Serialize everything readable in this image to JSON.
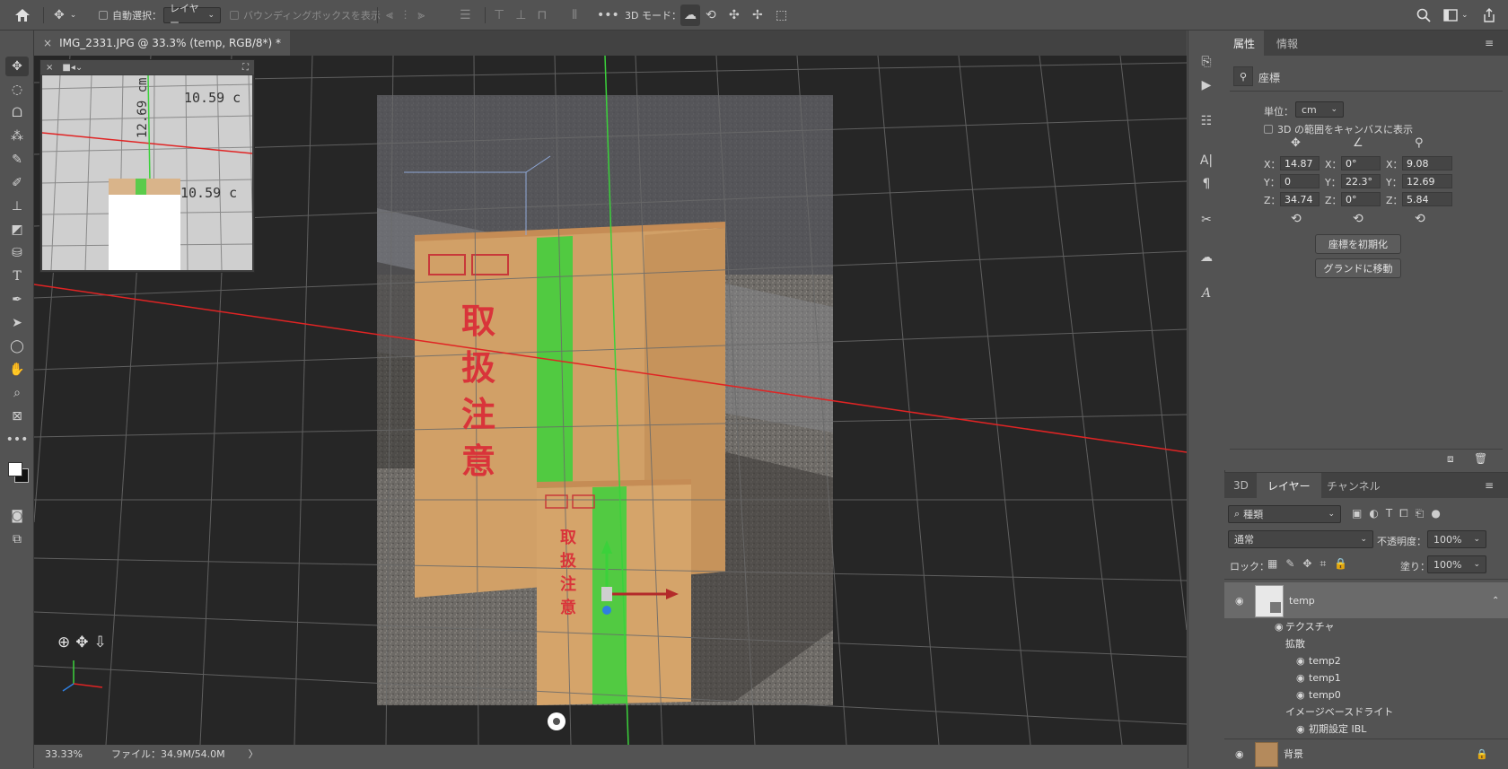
{
  "options_bar": {
    "auto_select_label": "自動選択：",
    "auto_select_value": "レイヤー",
    "bounding_box_label": "バウンディングボックスを表示",
    "mode_3d_label": "3D モード："
  },
  "document": {
    "tab_title": "IMG_2331.JPG @ 33.3% (temp, RGB/8*) *",
    "close_glyph": "×",
    "box_text_large": [
      "取",
      "扱",
      "注",
      "意"
    ],
    "box_text_small": [
      "取",
      "扱",
      "注",
      "意"
    ],
    "camera_measure_1": "10.59 c",
    "camera_measure_2": "12.69 cm",
    "camera_measure_3": "10.59 c"
  },
  "status_bar": {
    "zoom": "33.33%",
    "file_info": "ファイル：34.9M/54.0M",
    "arrow": "〉"
  },
  "properties": {
    "tab_properties": "属性",
    "tab_info": "情報",
    "section_title": "座標",
    "unit_label": "単位：",
    "unit_value": "cm",
    "show_extent_label": "3D の範囲をキャンバスに表示",
    "pos": {
      "x": "14.87",
      "y": "0",
      "z": "34.74"
    },
    "rot": {
      "x": "0°",
      "y": "22.3°",
      "z": "0°"
    },
    "scale": {
      "x": "9.08",
      "y": "12.69",
      "z": "5.84"
    },
    "axis_x": "X：",
    "axis_y": "Y：",
    "axis_z": "Z：",
    "reset_button": "座標を初期化",
    "ground_button": "グランドに移動"
  },
  "layers_panel": {
    "tab_3d": "3D",
    "tab_layers": "レイヤー",
    "tab_channels": "チャンネル",
    "filter_kind": "種類",
    "blend_mode": "通常",
    "opacity_label": "不透明度：",
    "opacity_value": "100%",
    "lock_label": "ロック：",
    "fill_label": "塗り：",
    "fill_value": "100%",
    "layers": {
      "temp": "temp",
      "texture": "テクスチャ",
      "diffuse": "拡散",
      "temp2": "temp2",
      "temp1": "temp1",
      "temp0": "temp0",
      "ibl_group": "イメージベースドライト",
      "ibl_default": "初期設定 IBL",
      "background": "背景"
    }
  },
  "colors": {
    "accent_green": "#3bd13b",
    "accent_red": "#e02424",
    "box_red": "#d9343a",
    "box_tan": "#d1a067"
  }
}
